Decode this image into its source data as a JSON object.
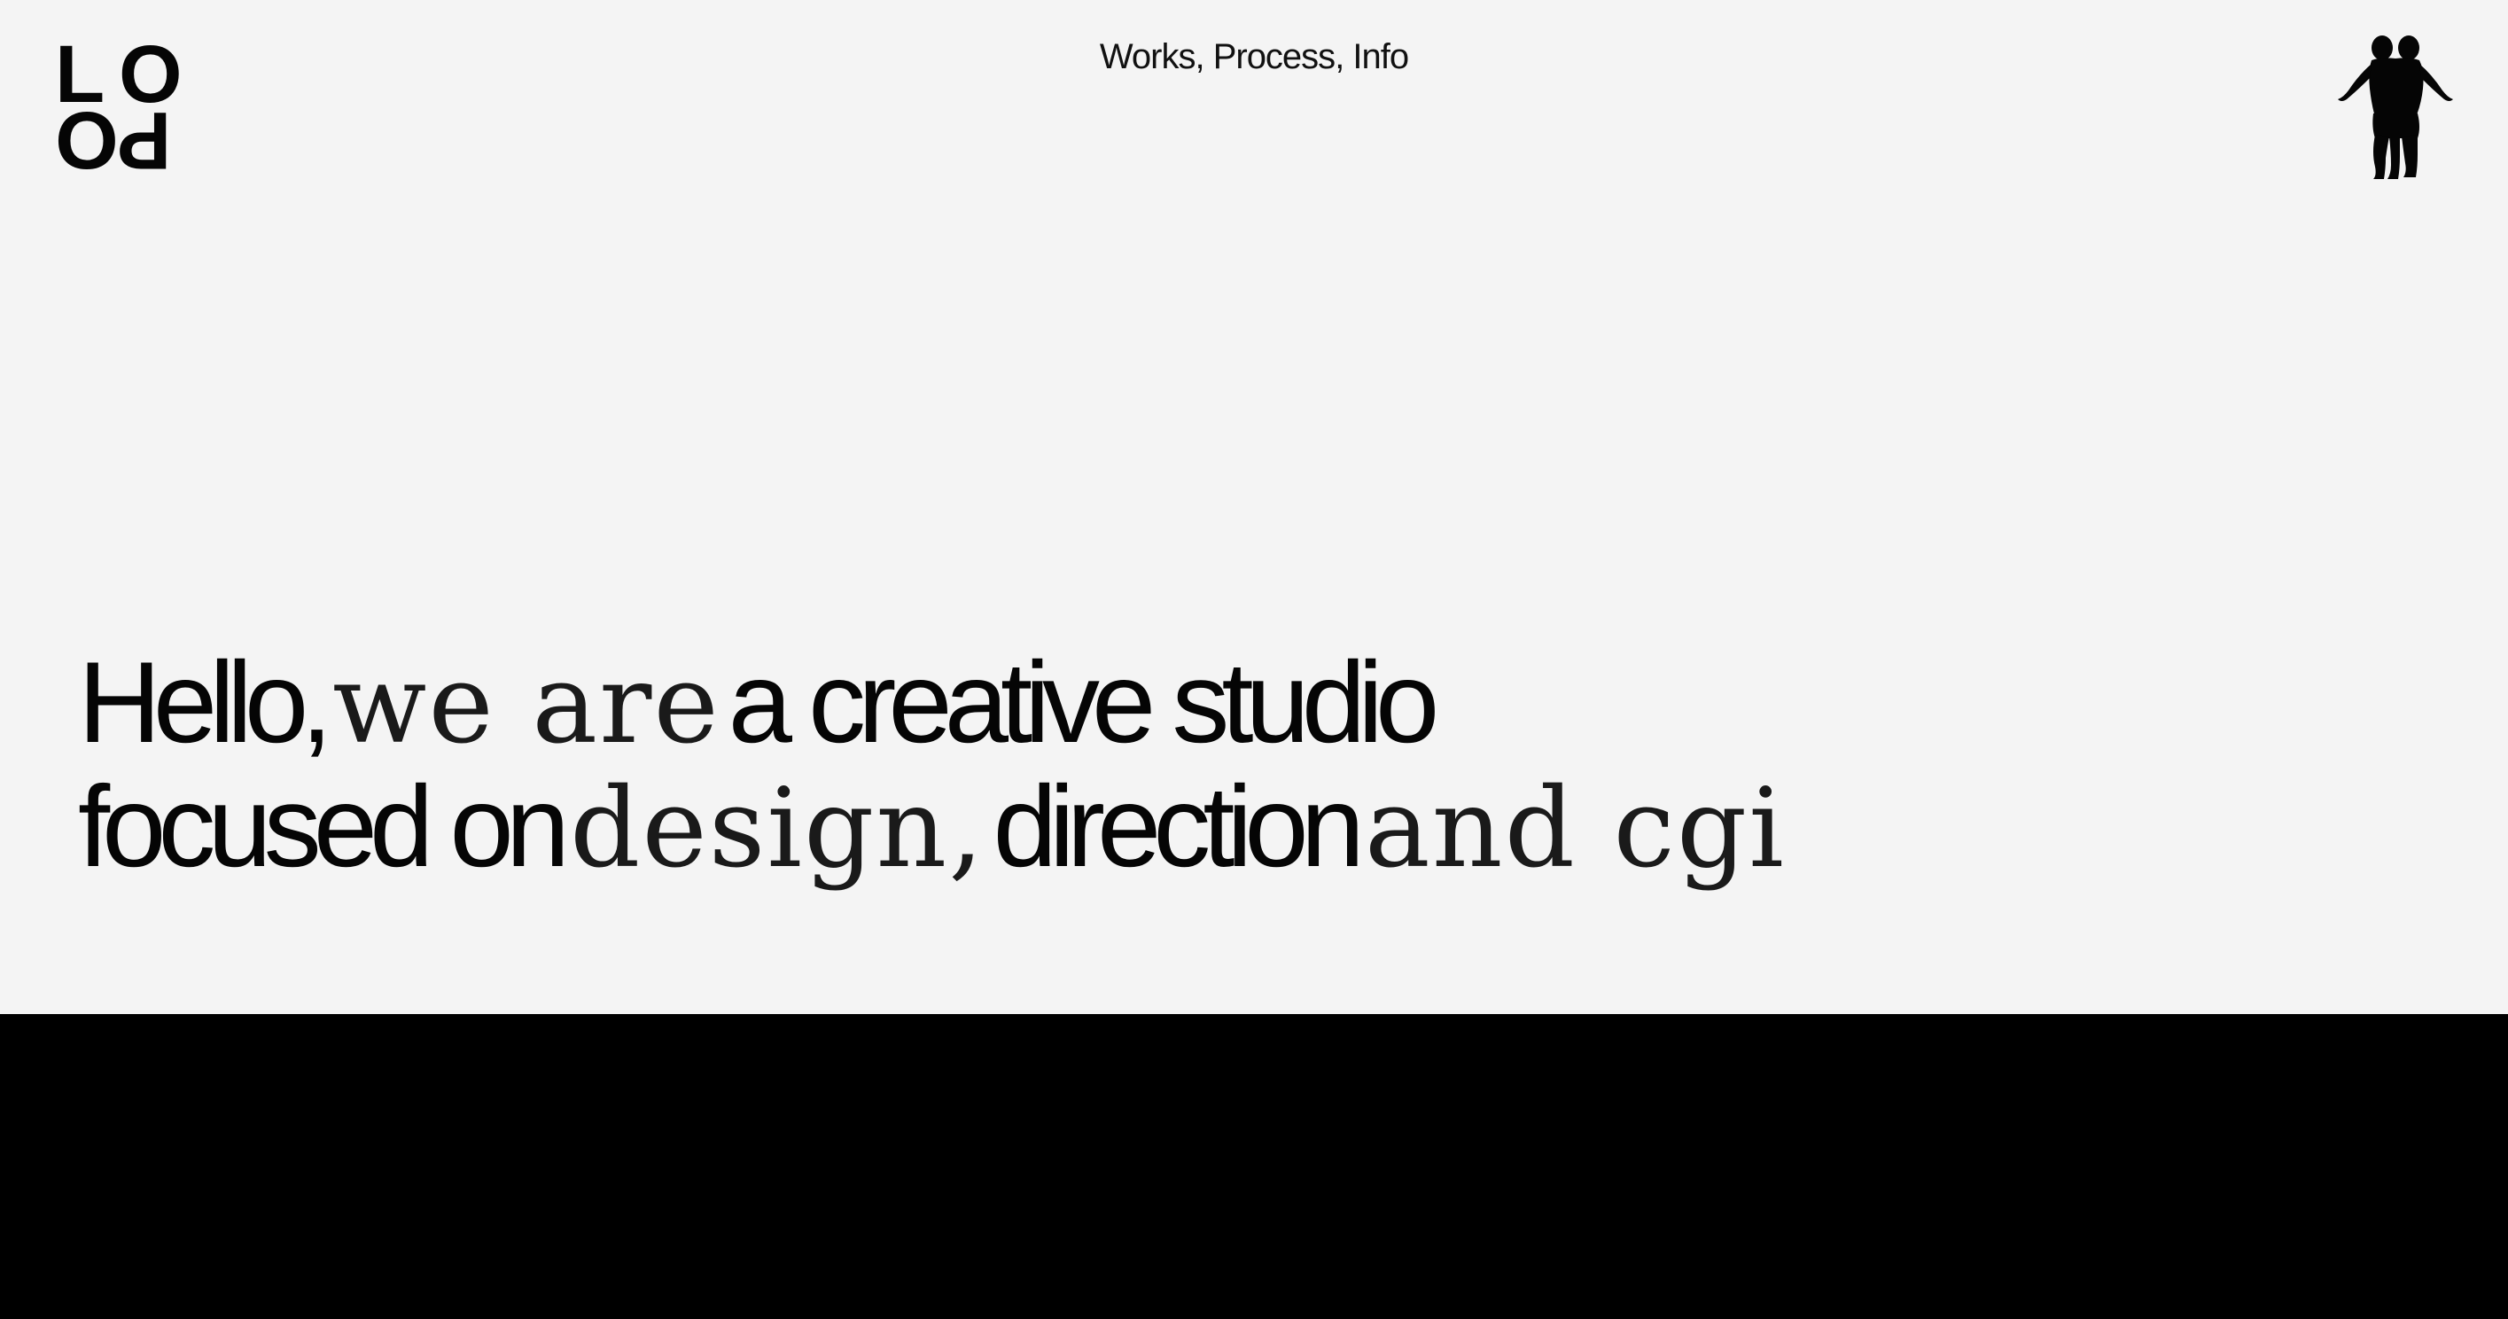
{
  "logo": {
    "letters": [
      "L",
      "O",
      "O",
      "P"
    ]
  },
  "nav": {
    "items": [
      "Works",
      "Process",
      "Info"
    ],
    "separator": ", "
  },
  "emblem": {
    "icon": "twin-figure-icon"
  },
  "hero": {
    "line1": {
      "part1": "Hello,",
      "part2": "we are",
      "part3": "a creative studio"
    },
    "line2": {
      "part1": "focused on",
      "part2": "design,",
      "part3": "direction",
      "part4": "and cgi"
    }
  },
  "colors": {
    "background": "#f4f4f4",
    "text": "#050505",
    "footer_band": "#000000"
  }
}
